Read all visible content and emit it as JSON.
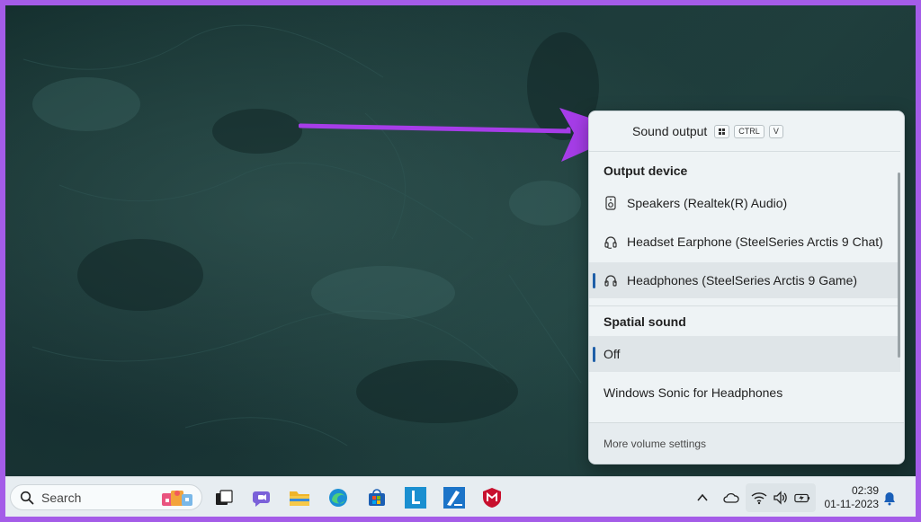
{
  "flyout": {
    "title": "Sound output",
    "shortcut_keys": [
      "CTRL",
      "V"
    ],
    "output_device_label": "Output device",
    "devices": [
      {
        "label": "Speakers (Realtek(R) Audio)",
        "icon": "speaker-icon",
        "selected": false
      },
      {
        "label": "Headset Earphone (SteelSeries Arctis 9 Chat)",
        "icon": "headset-icon",
        "selected": false
      },
      {
        "label": "Headphones (SteelSeries Arctis 9 Game)",
        "icon": "headphones-icon",
        "selected": true
      }
    ],
    "spatial_sound_label": "Spatial sound",
    "spatial_options": [
      {
        "label": "Off",
        "selected": true
      },
      {
        "label": "Windows Sonic for Headphones",
        "selected": false
      }
    ],
    "footer_link": "More volume settings"
  },
  "taskbar": {
    "search_placeholder": "Search",
    "apps": [
      "task-view-icon",
      "teams-chat-icon",
      "file-explorer-icon",
      "edge-icon",
      "microsoft-store-icon",
      "l-app-icon",
      "pen-app-icon",
      "mcafee-icon"
    ],
    "tray_icons": [
      "chevron-up-icon",
      "onedrive-cloud-icon",
      "wifi-icon",
      "volume-icon",
      "battery-icon"
    ],
    "time": "02:39",
    "date": "01-11-2023"
  },
  "colors": {
    "frame_border": "#a45ce8",
    "arrow": "#a63de8",
    "accent": "#1f5fa8"
  }
}
